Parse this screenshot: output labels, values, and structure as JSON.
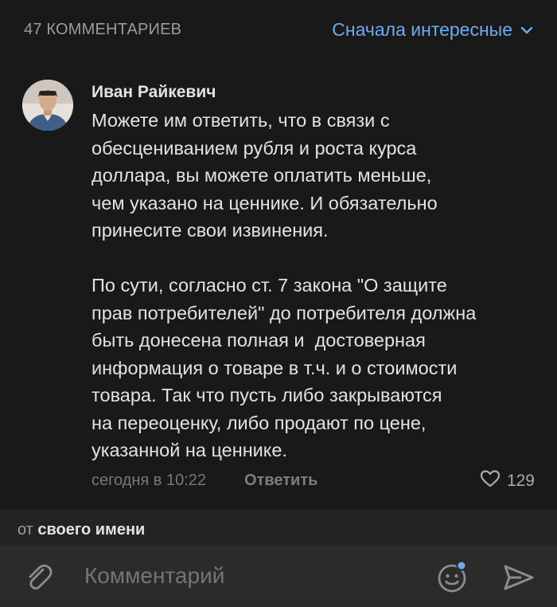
{
  "header": {
    "count_label": "47 КОММЕНТАРИЕВ",
    "sort_label": "Сначала интересные"
  },
  "comment": {
    "author": "Иван Райкевич",
    "text": "Можете им ответить, что в связи с\nобесцениванием рубля и роста курса\nдоллара, вы можете оплатить меньше,\nчем указано на ценнике. И обязательно\nпринесите свои извинения.\n\nПо сути, согласно ст. 7 закона \"О защите\nправ потребителей\" до потребителя должна\nбыть донесена полная и  достоверная\nинформация о товаре в т.ч. и о стоимости\nтовара. Так что пусть либо закрываются\nна переоценку, либо продают по цене,\nуказанной на ценнике.",
    "time": "сегодня в 10:22",
    "reply_label": "Ответить",
    "likes": "129"
  },
  "sender": {
    "prefix": "от",
    "name": "своего имени"
  },
  "input": {
    "placeholder": "Комментарий"
  },
  "icons": {
    "sort": "chevron-down-icon",
    "like": "heart-icon",
    "attach": "paperclip-icon",
    "emoji": "emoji-icon",
    "send": "send-icon"
  },
  "colors": {
    "accent": "#71aaeb",
    "background": "#19191a",
    "text": "#e1e3e6"
  }
}
